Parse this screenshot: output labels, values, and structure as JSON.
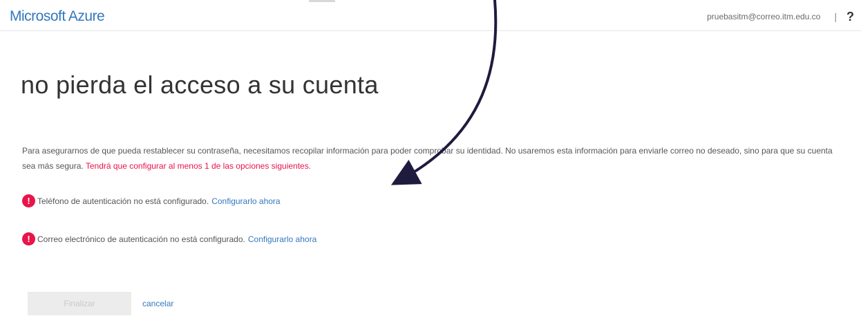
{
  "header": {
    "brand": "Microsoft Azure",
    "user_email": "pruebasitm@correo.itm.edu.co",
    "divider": "|",
    "help_icon": "?"
  },
  "main": {
    "title": "no pierda el acceso a su cuenta",
    "description": "Para asegurarnos de que pueda restablecer su contraseña, necesitamos recopilar información para poder comprobar su identidad. No usaremos esta información para enviarle correo no deseado, sino para que su cuenta sea más segura.",
    "description_required": "Tendrá que configurar al menos 1 de las opciones siguientes.",
    "items": [
      {
        "icon": "!",
        "text": "Teléfono de autenticación no está configurado.",
        "link": "Configurarlo ahora"
      },
      {
        "icon": "!",
        "text": "Correo electrónico de autenticación no está configurado.",
        "link": "Configurarlo ahora"
      }
    ],
    "finish_label": "Finalizar",
    "cancel_label": "cancelar"
  },
  "colors": {
    "brand": "#3478be",
    "link": "#3478be",
    "warning": "#e8144a",
    "arrow": "#1e1b3e"
  }
}
